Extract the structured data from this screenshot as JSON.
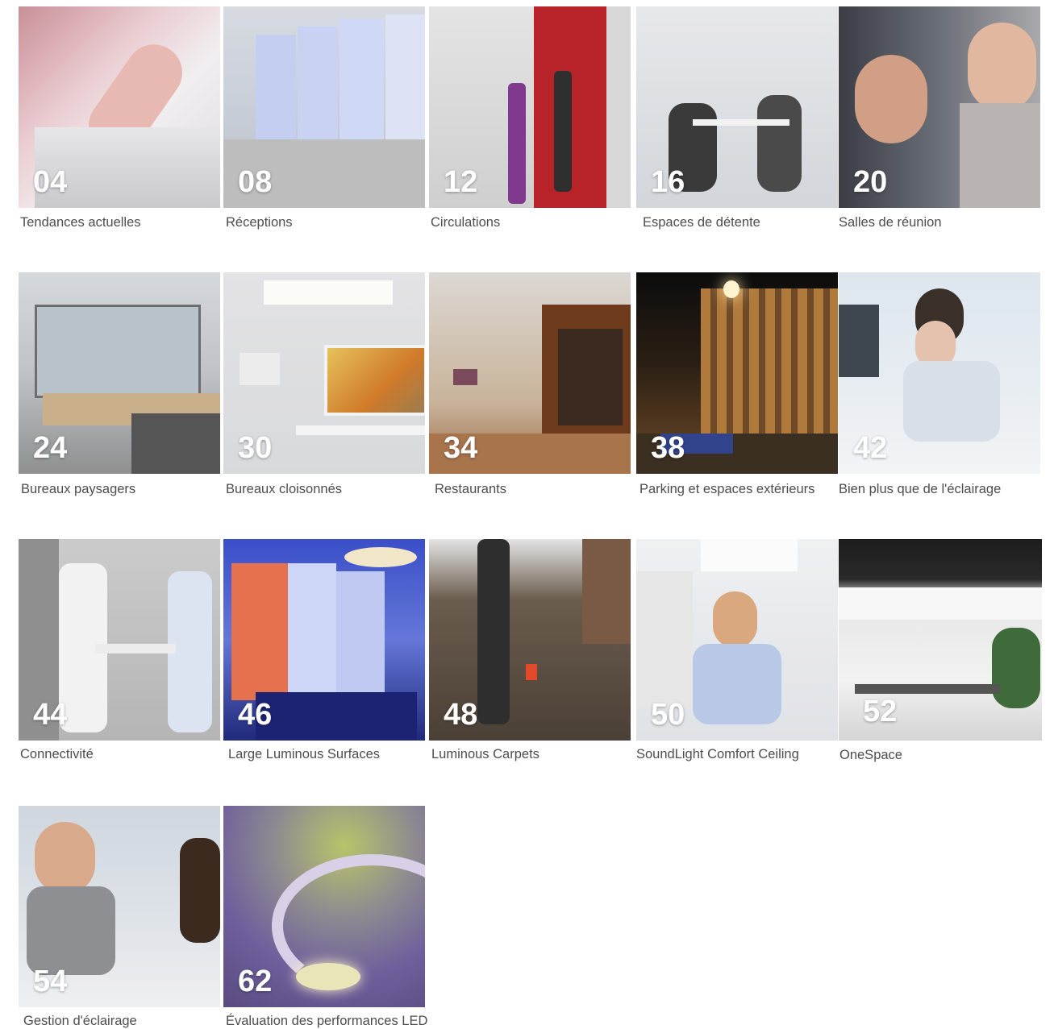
{
  "items": [
    {
      "page": "04",
      "title": "Tendances actuelles"
    },
    {
      "page": "08",
      "title": "Réceptions"
    },
    {
      "page": "12",
      "title": "Circulations"
    },
    {
      "page": "16",
      "title": "Espaces de détente"
    },
    {
      "page": "20",
      "title": "Salles de réunion"
    },
    {
      "page": "24",
      "title": "Bureaux paysagers"
    },
    {
      "page": "30",
      "title": "Bureaux cloisonnés"
    },
    {
      "page": "34",
      "title": "Restaurants"
    },
    {
      "page": "38",
      "title": "Parking et espaces extérieurs"
    },
    {
      "page": "42",
      "title": "Bien plus que de l'éclairage"
    },
    {
      "page": "44",
      "title": "Connectivité"
    },
    {
      "page": "46",
      "title": "Large Luminous Surfaces"
    },
    {
      "page": "48",
      "title": "Luminous Carpets"
    },
    {
      "page": "50",
      "title": "SoundLight Comfort Ceiling"
    },
    {
      "page": "52",
      "title": "OneSpace"
    },
    {
      "page": "54",
      "title": "Gestion d'éclairage"
    },
    {
      "page": "62",
      "title": "Évaluation des performances LED"
    }
  ]
}
